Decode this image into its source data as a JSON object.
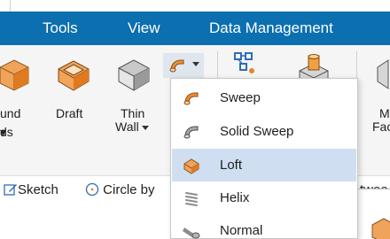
{
  "menubar": {
    "tools_label": "Tools",
    "view_label": "View",
    "data_management_label": "Data Management"
  },
  "ribbon": {
    "round_label": "und",
    "round_label_line2": "ds",
    "draft_label": "Draft",
    "thin_wall_label_line1": "Thin",
    "thin_wall_label_line2": "Wall",
    "mid_face_label_line1": "M",
    "mid_face_label_line2": "Fac",
    "icons": [
      "round-icon",
      "draft-icon",
      "thin-wall-icon",
      "sweep-icon",
      "pattern-icon",
      "create-solid-icon",
      "mid-face-icon"
    ]
  },
  "sketchbar": {
    "sketch_label": "Sketch",
    "circle_label": "Circle by",
    "between_label": "twee"
  },
  "dropdown": {
    "items": [
      {
        "label": "Sweep",
        "icon": "sweep-icon",
        "selected": false
      },
      {
        "label": "Solid Sweep",
        "icon": "solid-sweep-icon",
        "selected": false
      },
      {
        "label": "Loft",
        "icon": "loft-icon",
        "selected": true
      },
      {
        "label": "Helix",
        "icon": "helix-icon",
        "selected": false
      },
      {
        "label": "Normal",
        "icon": "normal-icon",
        "selected": false
      }
    ]
  },
  "colors": {
    "menubar": "#0b6fb0",
    "accent_orange": "#e8822a",
    "selection": "#cfdef0"
  }
}
